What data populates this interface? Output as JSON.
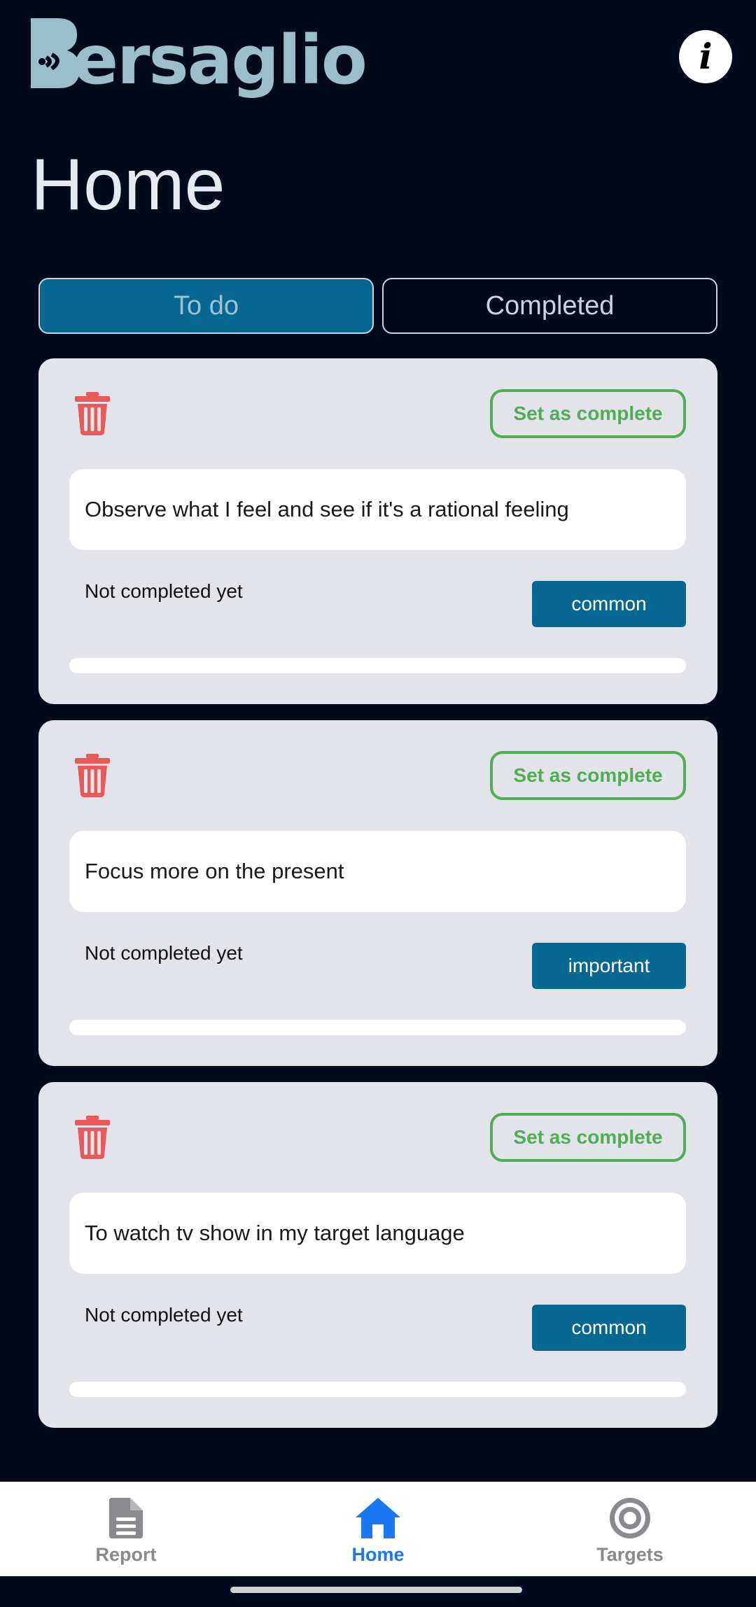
{
  "app": {
    "logo_text": "Bersaglio",
    "info_label": "i"
  },
  "page_title": "Home",
  "tabs": [
    {
      "label": "To do",
      "active": true
    },
    {
      "label": "Completed",
      "active": false
    }
  ],
  "tasks": [
    {
      "complete_label": "Set as complete",
      "text": "Observe what I feel and see if it's a rational feeling",
      "status": "Not completed yet",
      "priority": "common",
      "progress": 0
    },
    {
      "complete_label": "Set as complete",
      "text": "Focus more on the present",
      "status": "Not completed yet",
      "priority": "important",
      "progress": 0
    },
    {
      "complete_label": "Set as complete",
      "text": "To watch tv show in my target language",
      "status": "Not completed yet",
      "priority": "common",
      "progress": 0
    }
  ],
  "bottom_nav": [
    {
      "label": "Report",
      "icon": "document-icon",
      "active": false
    },
    {
      "label": "Home",
      "icon": "home-icon",
      "active": true
    },
    {
      "label": "Targets",
      "icon": "target-icon",
      "active": false
    }
  ],
  "colors": {
    "background": "#030a1c",
    "accent": "#066891",
    "complete_green": "#4fad54",
    "trash_red": "#e85a5a",
    "nav_active": "#1a78f0",
    "nav_inactive": "#8a8a8e"
  }
}
